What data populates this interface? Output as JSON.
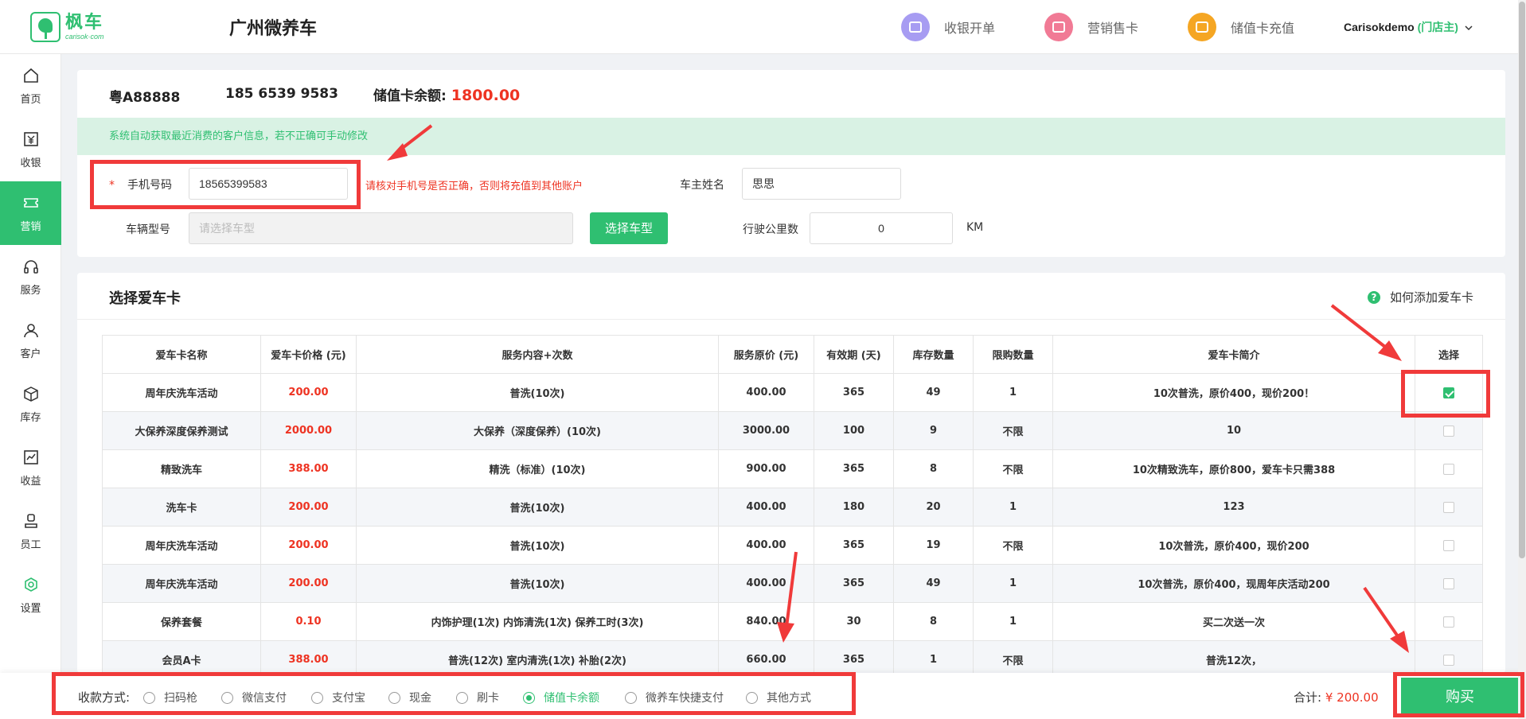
{
  "logo": {
    "cn": "枫车",
    "en": "carisok·com"
  },
  "header": {
    "shop_name": "广州微养车",
    "actions": [
      {
        "label": "收银开单",
        "color": "#a79cf2"
      },
      {
        "label": "营销售卡",
        "color": "#f17a95"
      },
      {
        "label": "储值卡充值",
        "color": "#f5a623"
      }
    ],
    "user": "Carisokdemo",
    "role": "(门店主)"
  },
  "sidebar": {
    "items": [
      {
        "label": "首页",
        "icon": "home-icon"
      },
      {
        "label": "收银",
        "icon": "yen-icon"
      },
      {
        "label": "营销",
        "icon": "ticket-icon"
      },
      {
        "label": "服务",
        "icon": "headset-icon"
      },
      {
        "label": "客户",
        "icon": "user-icon"
      },
      {
        "label": "库存",
        "icon": "box-icon"
      },
      {
        "label": "收益",
        "icon": "chart-icon"
      },
      {
        "label": "员工",
        "icon": "staff-icon"
      },
      {
        "label": "设置",
        "icon": "gear-icon"
      }
    ],
    "active": "营销"
  },
  "customer": {
    "plate": "粤A88888",
    "phone_display": "185 6539 9583",
    "balance_label": "储值卡余额:",
    "balance": "1800.00",
    "notice": "系统自动获取最近消费的客户信息，若不正确可手动修改"
  },
  "form": {
    "required_mark": "*",
    "phone_label": "手机号码",
    "phone_value": "18565399583",
    "phone_warning": "请核对手机号是否正确，否则将充值到其他账户",
    "owner_label": "车主姓名",
    "owner_value": "思思",
    "model_label": "车辆型号",
    "model_placeholder": "请选择车型",
    "select_model_button": "选择车型",
    "mileage_label": "行驶公里数",
    "mileage_value": "0",
    "mileage_unit": "KM"
  },
  "cards_section": {
    "title": "选择爱车卡",
    "help": "如何添加爱车卡",
    "columns": [
      "爱车卡名称",
      "爱车卡价格 (元)",
      "服务内容+次数",
      "服务原价 (元)",
      "有效期 (天)",
      "库存数量",
      "限购数量",
      "爱车卡简介",
      "选择"
    ],
    "rows": [
      {
        "name": "周年庆洗车活动",
        "price": "200.00",
        "content": "普洗(10次)",
        "orig": "400.00",
        "days": "365",
        "stock": "49",
        "limit": "1",
        "desc": "10次普洗，原价400，现价200！",
        "selected": true
      },
      {
        "name": "大保养深度保养测试",
        "price": "2000.00",
        "content": "大保养（深度保养）(10次)",
        "orig": "3000.00",
        "days": "100",
        "stock": "9",
        "limit": "不限",
        "desc": "10",
        "selected": false
      },
      {
        "name": "精致洗车",
        "price": "388.00",
        "content": "精洗（标准）(10次)",
        "orig": "900.00",
        "days": "365",
        "stock": "8",
        "limit": "不限",
        "desc": "10次精致洗车，原价800，爱车卡只需388",
        "selected": false
      },
      {
        "name": "洗车卡",
        "price": "200.00",
        "content": "普洗(10次)",
        "orig": "400.00",
        "days": "180",
        "stock": "20",
        "limit": "1",
        "desc": "123",
        "selected": false
      },
      {
        "name": "周年庆洗车活动",
        "price": "200.00",
        "content": "普洗(10次)",
        "orig": "400.00",
        "days": "365",
        "stock": "19",
        "limit": "不限",
        "desc": "10次普洗，原价400，现价200",
        "selected": false
      },
      {
        "name": "周年庆洗车活动",
        "price": "200.00",
        "content": "普洗(10次)",
        "orig": "400.00",
        "days": "365",
        "stock": "49",
        "limit": "1",
        "desc": "10次普洗，原价400，现周年庆活动200",
        "selected": false
      },
      {
        "name": "保养套餐",
        "price": "0.10",
        "content": "内饰护理(1次) 内饰清洗(1次) 保养工时(3次)",
        "orig": "840.00",
        "days": "30",
        "stock": "8",
        "limit": "1",
        "desc": "买二次送一次",
        "selected": false
      },
      {
        "name": "会员A卡",
        "price": "388.00",
        "content": "普洗(12次) 室内清洗(1次) 补胎(2次)",
        "orig": "660.00",
        "days": "365",
        "stock": "1",
        "limit": "不限",
        "desc": "普洗12次，",
        "selected": false
      }
    ]
  },
  "payment": {
    "label": "收款方式:",
    "options": [
      "扫码枪",
      "微信支付",
      "支付宝",
      "现金",
      "刷卡",
      "储值卡余额",
      "微养车快捷支付",
      "其他方式"
    ],
    "selected": "储值卡余额",
    "total_label": "合计:",
    "total_value": "¥ 200.00",
    "buy_button": "购买"
  },
  "colors": {
    "brand": "#2fbf71",
    "danger": "#ee3322",
    "annotation": "#f03a3a"
  }
}
